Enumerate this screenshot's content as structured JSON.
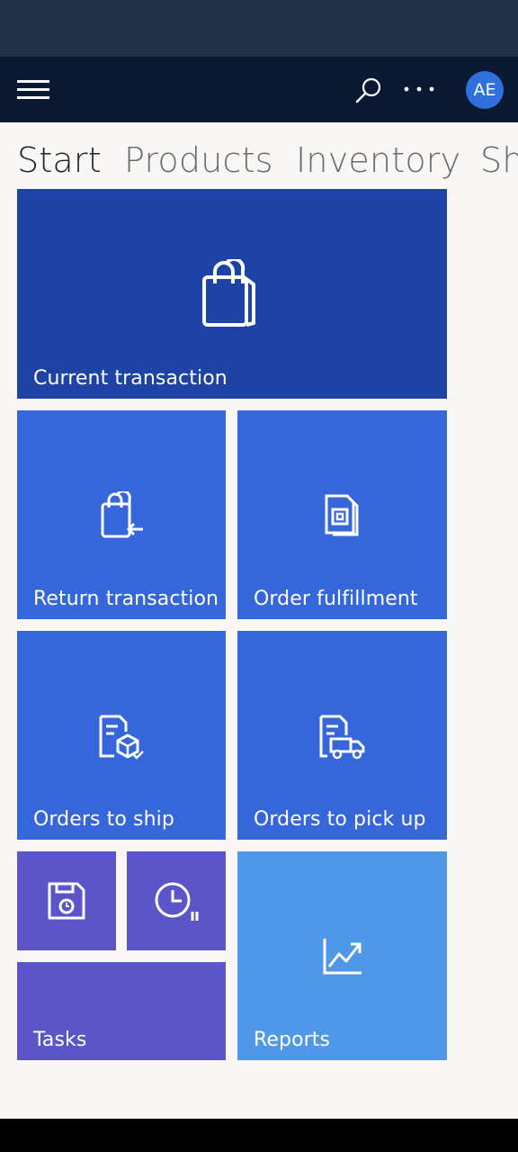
{
  "header": {
    "avatar_initials": "AE",
    "icons": [
      "hamburger-menu-icon",
      "search-icon",
      "more-options-icon"
    ]
  },
  "tabs": [
    {
      "label": "Start",
      "active": true
    },
    {
      "label": "Products",
      "active": false
    },
    {
      "label": "Inventory",
      "active": false
    },
    {
      "label": "Sh",
      "active": false
    }
  ],
  "tiles": {
    "current_transaction": {
      "label": "Current transaction",
      "icon": "shopping-bag-icon",
      "color": "#1c43a5"
    },
    "return_transaction": {
      "label": "Return transaction",
      "icon": "return-bag-icon",
      "color": "#3566da"
    },
    "order_fulfillment": {
      "label": "Order fulfillment",
      "icon": "order-document-icon",
      "color": "#3566da"
    },
    "orders_to_ship": {
      "label": "Orders to ship",
      "icon": "ship-package-icon",
      "color": "#3566da"
    },
    "orders_to_pick_up": {
      "label": "Orders to pick up",
      "icon": "pickup-truck-icon",
      "color": "#3566da"
    },
    "save_tile": {
      "icon": "save-disk-icon",
      "color": "#5b55c9"
    },
    "timeclock_tile": {
      "icon": "timeclock-icon",
      "color": "#5b55c9"
    },
    "tasks": {
      "label": "Tasks",
      "color": "#5b55c9"
    },
    "reports": {
      "label": "Reports",
      "icon": "chart-trend-icon",
      "color": "#4f98e8"
    }
  },
  "colors": {
    "status_bar": "#223147",
    "app_bar": "#0b1a33",
    "background": "#f8f7f6",
    "avatar": "#2f6fde"
  }
}
